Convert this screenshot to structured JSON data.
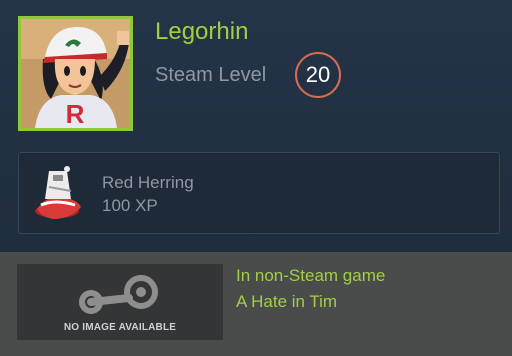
{
  "profile": {
    "username": "Legorhin",
    "level_label": "Steam Level",
    "level_value": "20",
    "avatar_icon": "anime-boy-cap-avatar"
  },
  "badge": {
    "icon": "red-herring-fish-icon",
    "name": "Red Herring",
    "xp": "100 XP"
  },
  "game": {
    "thumbnail_icon": "steam-logo-icon",
    "thumbnail_text": "NO IMAGE AVAILABLE",
    "status": "In non-Steam game",
    "name": "A Hate in Tim"
  },
  "colors": {
    "accent_green": "#a1cf43",
    "level_ring": "#d96b52",
    "panel_bg": "#243447",
    "game_bg": "#4a4c4c"
  }
}
